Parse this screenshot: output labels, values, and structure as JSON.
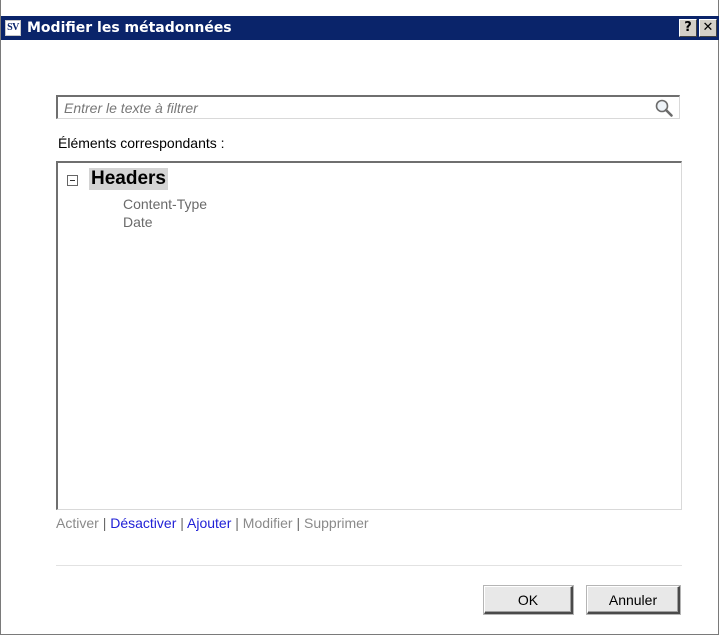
{
  "window": {
    "app_icon_text": "SV",
    "title": "Modifier les métadonnées",
    "help_label": "?",
    "close_label": "✕"
  },
  "filter": {
    "value": "",
    "placeholder": "Entrer le texte à filtrer",
    "icon": "search-icon"
  },
  "matches_label": "Éléments correspondants :",
  "tree": {
    "root": {
      "label": "Headers",
      "expanded": true,
      "toggle_icon": "minus-box-icon",
      "children": [
        "Content-Type",
        "Date"
      ]
    }
  },
  "actions": {
    "items": [
      {
        "label": "Activer",
        "enabled": false
      },
      {
        "label": "Désactiver",
        "enabled": true
      },
      {
        "label": "Ajouter",
        "enabled": true
      },
      {
        "label": "Modifier",
        "enabled": false
      },
      {
        "label": "Supprimer",
        "enabled": false
      }
    ],
    "separator": "|"
  },
  "buttons": {
    "ok": "OK",
    "cancel": "Annuler"
  },
  "colors": {
    "title_bar": "#0a246a",
    "link_enabled": "#1f1fd6",
    "link_disabled": "#8a8a8a"
  }
}
